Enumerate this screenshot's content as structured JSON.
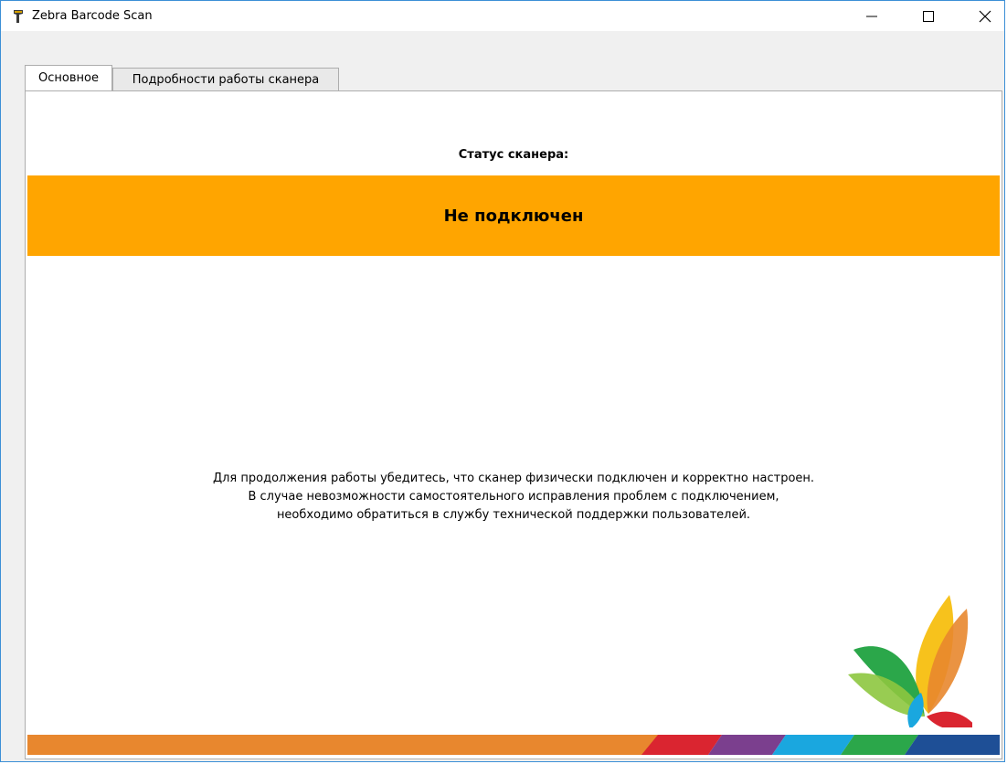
{
  "window": {
    "title": "Zebra Barcode Scan"
  },
  "tabs": [
    {
      "label": "Основное",
      "active": true
    },
    {
      "label": "Подробности работы сканера",
      "active": false
    }
  ],
  "status": {
    "label": "Статус сканера:",
    "value": "Не подключен",
    "color": "#ffa500"
  },
  "message": {
    "line1": "Для продолжения работы убедитесь, что сканер физически подключен и корректно настроен.",
    "line2": "В случае невозможности самостоятельного исправления проблем с подключением,",
    "line3": "необходимо обратиться в службу технической поддержки пользователей."
  },
  "brand_colors": [
    "#e8872e",
    "#da2530",
    "#7b3f8e",
    "#1aa7df",
    "#2ba74a",
    "#1e4f96",
    "#f7c21c"
  ]
}
